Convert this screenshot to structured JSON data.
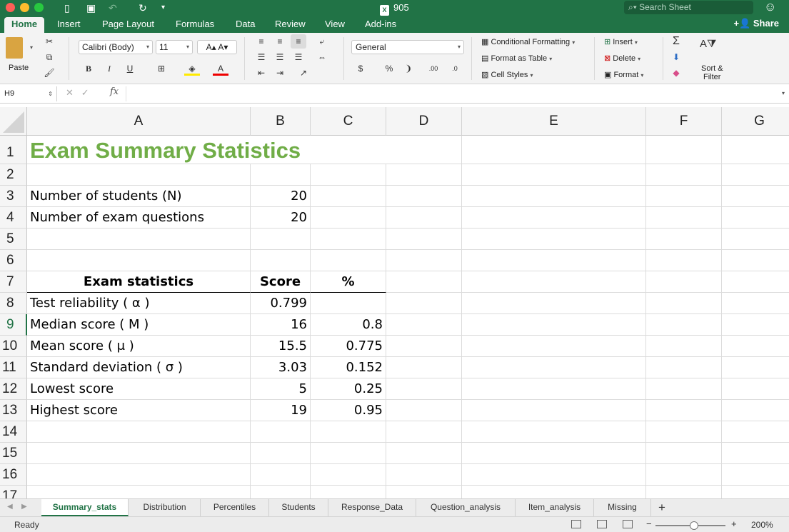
{
  "window": {
    "title": "905",
    "search_placeholder": "Search Sheet"
  },
  "ribbon_tabs": [
    "Home",
    "Insert",
    "Page Layout",
    "Formulas",
    "Data",
    "Review",
    "View",
    "Add-ins"
  ],
  "share_label": "Share",
  "ribbon": {
    "paste_label": "Paste",
    "font_name": "Calibri (Body)",
    "font_size": "11",
    "number_format": "General",
    "conditional_formatting": "Conditional Formatting",
    "format_as_table": "Format as Table",
    "cell_styles": "Cell Styles",
    "insert_label": "Insert",
    "delete_label": "Delete",
    "format_label": "Format",
    "sort_filter_label": "Sort &",
    "sort_filter_label2": "Filter"
  },
  "formula_bar": {
    "name_box": "H9",
    "fx": "fx",
    "content": ""
  },
  "columns": [
    "A",
    "B",
    "C",
    "D",
    "E",
    "F",
    "G"
  ],
  "rows": [
    "1",
    "2",
    "3",
    "4",
    "5",
    "6",
    "7",
    "8",
    "9",
    "10",
    "11",
    "12",
    "13",
    "14",
    "15",
    "16",
    "17"
  ],
  "sheet": {
    "title": "Exam Summary Statistics",
    "n_students_label": "Number of students (N)",
    "n_students": "20",
    "n_questions_label": "Number of exam questions",
    "n_questions": "20",
    "stats_header": "Exam statistics",
    "score_header": "Score",
    "pct_header": "%",
    "stats": [
      {
        "label": "Test reliability ( α )",
        "score": "0.799",
        "pct": ""
      },
      {
        "label": "Median score ( M )",
        "score": "16",
        "pct": "0.8"
      },
      {
        "label": "Mean score ( μ )",
        "score": "15.5",
        "pct": "0.775"
      },
      {
        "label": "Standard deviation ( σ )",
        "score": "3.03",
        "pct": "0.152"
      },
      {
        "label": "Lowest score",
        "score": "5",
        "pct": "0.25"
      },
      {
        "label": "Highest score",
        "score": "19",
        "pct": "0.95"
      }
    ]
  },
  "sheet_tabs": [
    "Summary_stats",
    "Distribution",
    "Percentiles",
    "Students",
    "Response_Data",
    "Question_analysis",
    "Item_analysis",
    "Missing"
  ],
  "status": {
    "text": "Ready",
    "zoom": "200%",
    "zoom_fraction": 0.55
  },
  "colors": {
    "accent": "#217346",
    "title_green": "#70ad47"
  }
}
